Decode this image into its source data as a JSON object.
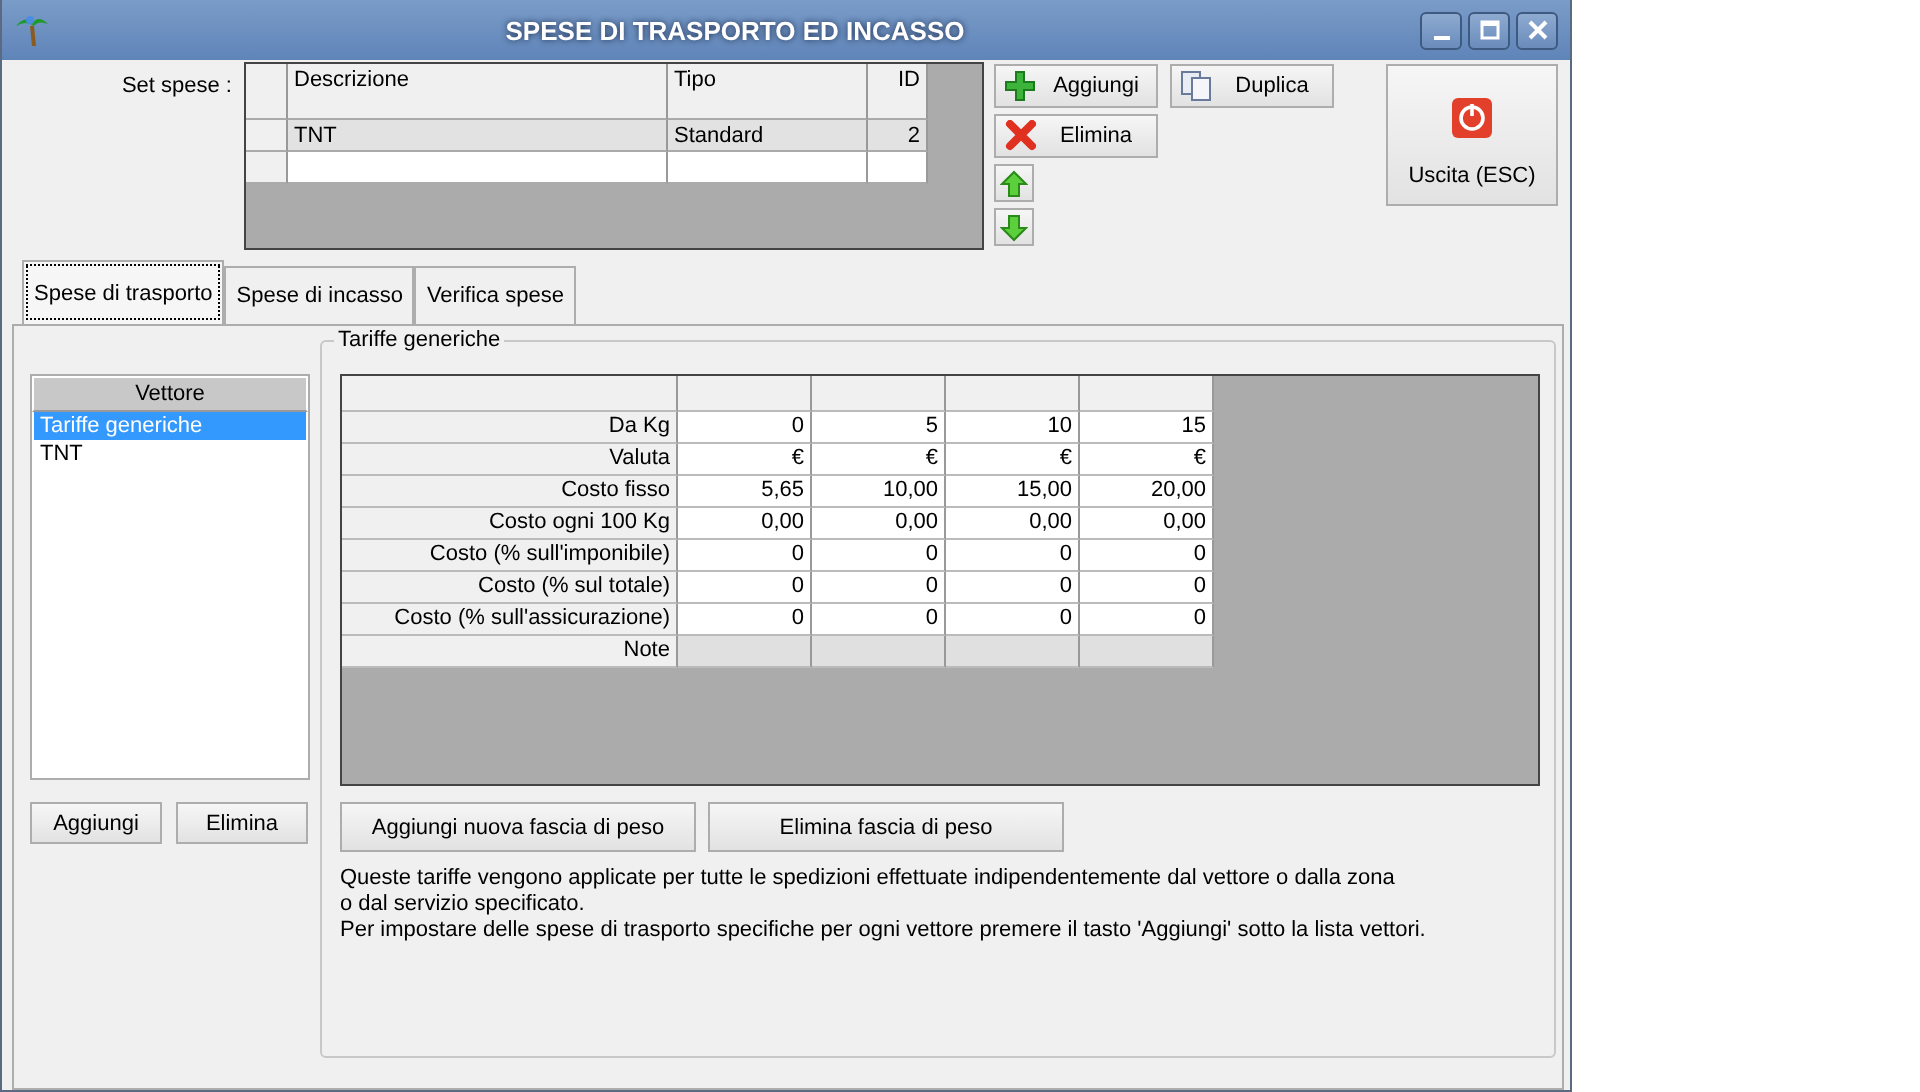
{
  "window": {
    "title": "SPESE DI TRASPORTO ED INCASSO"
  },
  "set_spese": {
    "label": "Set spese :",
    "columns": [
      "Descrizione",
      "Tipo",
      "ID"
    ],
    "rows": [
      {
        "selected": true,
        "cells": [
          "TNT",
          "Standard",
          "2"
        ]
      },
      {
        "selected": false
      }
    ]
  },
  "set_buttons": {
    "add": "Aggiungi",
    "duplicate": "Duplica",
    "delete": "Elimina",
    "exit": "Uscita (ESC)"
  },
  "tabs": [
    {
      "label": "Spese di trasporto",
      "selected": true
    },
    {
      "label": "Spese di incasso",
      "selected": false
    },
    {
      "label": "Verifica spese",
      "selected": false
    }
  ],
  "vettori": {
    "header": "Vettore",
    "items": [
      {
        "label": "Tariffe generiche",
        "selected": true
      },
      {
        "label": "TNT",
        "selected": false
      }
    ],
    "add": "Aggiungi",
    "delete": "Elimina"
  },
  "tariffe": {
    "title": "Tariffe generiche",
    "rows": [
      {
        "kind": "value",
        "label": "Da Kg",
        "values": [
          "0",
          "5",
          "10",
          "15"
        ]
      },
      {
        "kind": "value",
        "label": "Valuta",
        "values": [
          "€",
          "€",
          "€",
          "€"
        ]
      },
      {
        "kind": "value",
        "label": "Costo fisso",
        "values": [
          "5,65",
          "10,00",
          "15,00",
          "20,00"
        ]
      },
      {
        "kind": "value",
        "label": "Costo ogni 100 Kg",
        "values": [
          "0,00",
          "0,00",
          "0,00",
          "0,00"
        ]
      },
      {
        "kind": "value",
        "label": "Costo (% sull'imponibile)",
        "values": [
          "0",
          "0",
          "0",
          "0"
        ]
      },
      {
        "kind": "value",
        "label": "Costo (% sul totale)",
        "values": [
          "0",
          "0",
          "0",
          "0"
        ]
      },
      {
        "kind": "value",
        "label": "Costo (% sull'assicurazione)",
        "values": [
          "0",
          "0",
          "0",
          "0"
        ]
      },
      {
        "kind": "note",
        "label": "Note"
      }
    ],
    "add": "Aggiungi nuova fascia di peso",
    "delete": "Elimina fascia di peso",
    "notes": [
      "Queste tariffe vengono applicate per tutte le spedizioni effettuate indipendentemente dal vettore o dalla zona",
      "o dal servizio specificato.",
      "Per impostare delle spese di trasporto specifiche per ogni vettore premere il tasto 'Aggiungi' sotto la lista vettori."
    ]
  }
}
